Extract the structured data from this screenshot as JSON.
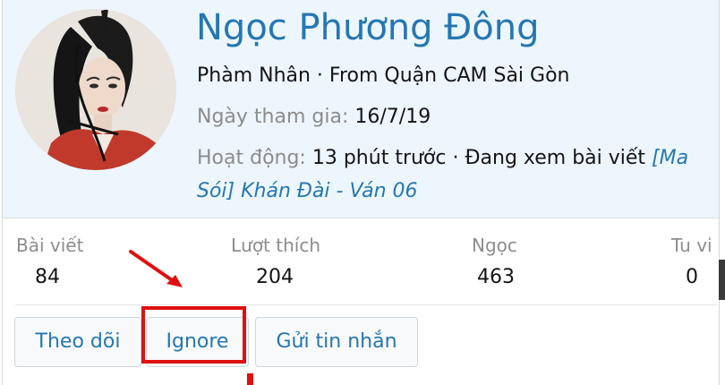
{
  "profile": {
    "name": "Ngọc Phương Đông",
    "subtitle": "Phàm Nhân · From Quận CAM Sài Gòn",
    "joined_label": "Ngày tham gia:",
    "joined_value": "16/7/19",
    "activity_label": "Hoạt động:",
    "activity_value": "13 phút trước · Đang xem bài viết",
    "activity_link_part1": "[Ma",
    "activity_link_part2": "Sói] Khán Đài - Ván 06"
  },
  "stats": [
    {
      "label": "Bài viết",
      "value": "84"
    },
    {
      "label": "Lượt thích",
      "value": "204"
    },
    {
      "label": "Ngọc",
      "value": "463"
    },
    {
      "label": "Tu vi",
      "value": "0"
    }
  ],
  "actions": {
    "follow": "Theo dõi",
    "ignore": "Ignore",
    "message": "Gửi tin nhắn"
  },
  "colors": {
    "accent": "#2577b1",
    "header_bg": "#edf6fd",
    "highlight": "#e01010"
  },
  "icons": {
    "annotation": "red-arrow-icon"
  }
}
